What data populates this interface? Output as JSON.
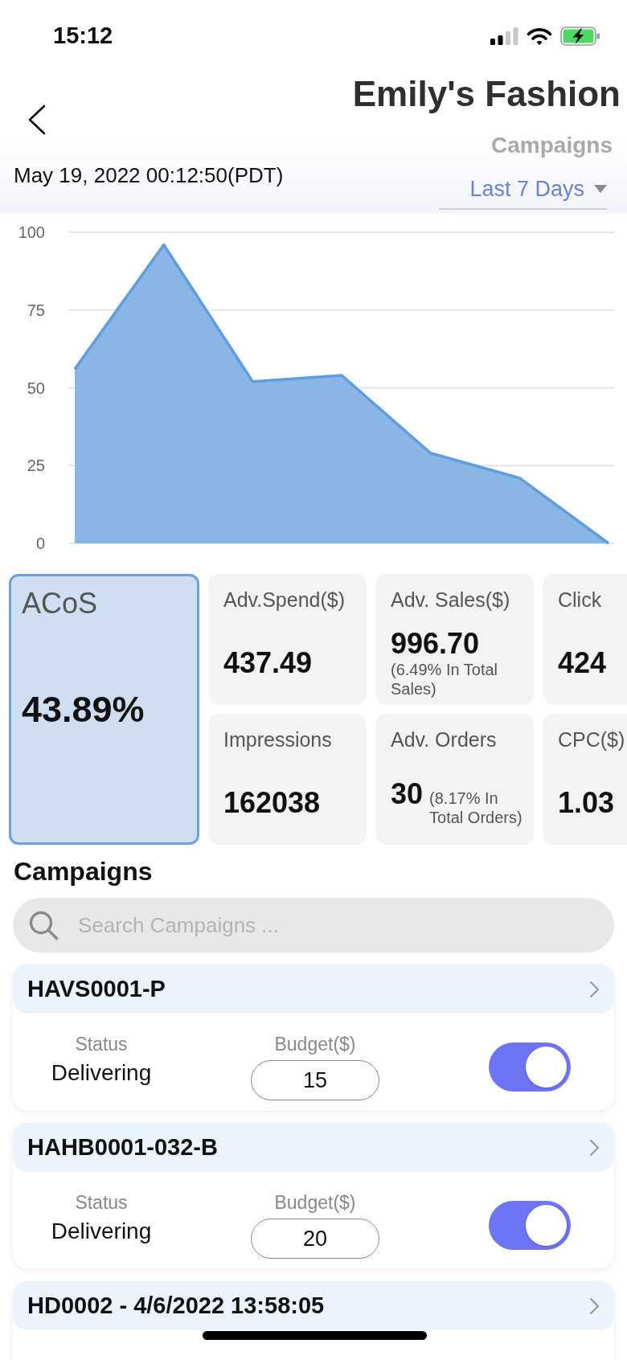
{
  "status_bar": {
    "time": "15:12"
  },
  "header": {
    "title": "Emily's Fashion",
    "subtitle": "Campaigns",
    "timestamp": "May 19, 2022 00:12:50(PDT)",
    "range": "Last 7 Days"
  },
  "chart": {
    "chart_data": {
      "type": "area",
      "values": [
        56,
        96,
        52,
        54,
        29,
        21,
        0
      ],
      "ylim": [
        0,
        100
      ],
      "yticks": [
        0,
        25,
        50,
        75,
        100
      ],
      "grid": true
    }
  },
  "metrics": [
    {
      "label": "ACoS",
      "value": "43.89%",
      "selected": true
    },
    {
      "label": "Adv.Spend($)",
      "value": "437.49",
      "selected": false
    },
    {
      "label": "Adv. Sales($)",
      "value": "996.70",
      "note": "(6.49% In Total Sales)",
      "selected": false
    },
    {
      "label": "Click",
      "value": "424",
      "selected": false
    },
    {
      "label": "Impressions",
      "value": "162038",
      "selected": false
    },
    {
      "label": "Adv. Orders",
      "value": "30",
      "note": "(8.17% In Total Orders)",
      "selected": false
    },
    {
      "label": "CPC($)",
      "value": "1.03",
      "selected": false
    }
  ],
  "campaigns": {
    "title": "Campaigns",
    "search": {
      "placeholder": "Search Campaigns ..."
    },
    "items": [
      {
        "name": "HAVS0001-P",
        "status_label": "Status",
        "status": "Delivering",
        "budget_label": "Budget($)",
        "budget": "15",
        "on": true
      },
      {
        "name": "HAHB0001-032-B",
        "status_label": "Status",
        "status": "Delivering",
        "budget_label": "Budget($)",
        "budget": "20",
        "on": true
      },
      {
        "name": "HD0002 - 4/6/2022 13:58:05"
      }
    ]
  }
}
